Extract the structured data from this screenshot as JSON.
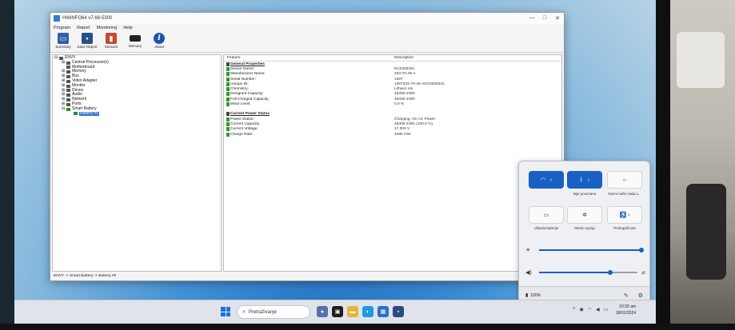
{
  "window": {
    "title": "HWiNFO64 v7.68-5300",
    "controls": [
      "—",
      "□",
      "✕"
    ]
  },
  "menu": [
    "Program",
    "Report",
    "Monitoring",
    "Help"
  ],
  "toolbar": {
    "summary": "Summary",
    "save_report": "Save Report",
    "sensors": "Sensors",
    "memory": "Memory",
    "about": "About"
  },
  "tree": [
    {
      "label": "ENVY",
      "indent": 0,
      "expander": "⊟"
    },
    {
      "label": "Central Processor(s)",
      "indent": 1,
      "expander": "⊞"
    },
    {
      "label": "Motherboard",
      "indent": 1,
      "expander": ""
    },
    {
      "label": "Memory",
      "indent": 1,
      "expander": "⊞"
    },
    {
      "label": "Bus",
      "indent": 1,
      "expander": "⊞"
    },
    {
      "label": "Video Adapter",
      "indent": 1,
      "expander": "⊞"
    },
    {
      "label": "Monitor",
      "indent": 1,
      "expander": "⊞"
    },
    {
      "label": "Drives",
      "indent": 1,
      "expander": "⊞"
    },
    {
      "label": "Audio",
      "indent": 1,
      "expander": "⊞"
    },
    {
      "label": "Network",
      "indent": 1,
      "expander": "⊞"
    },
    {
      "label": "Ports",
      "indent": 1,
      "expander": "⊞"
    },
    {
      "label": "Smart Battery",
      "indent": 1,
      "expander": "⊟"
    },
    {
      "label": "Battery #0",
      "indent": 2,
      "expander": "",
      "selected": true
    }
  ],
  "details": {
    "col_feature": "Feature",
    "col_description": "Description",
    "general_header": "General Properties",
    "general": [
      {
        "feature": "Device Name:",
        "value": "KC04053XL"
      },
      {
        "feature": "Manufacturer Name:",
        "value": "333-70-49-A"
      },
      {
        "feature": "Serial Number:",
        "value": "1367"
      },
      {
        "feature": "Unique ID:",
        "value": "1367333-70-49-AKC04053XL"
      },
      {
        "feature": "Chemistry:",
        "value": "Lithium Ion"
      },
      {
        "feature": "Designed Capacity:",
        "value": "45330 mWh"
      },
      {
        "feature": "Full Charged Capacity:",
        "value": "45330 mWh"
      },
      {
        "feature": "Wear Level:",
        "value": "0.0 %"
      }
    ],
    "power_header": "Current Power Status",
    "power": [
      {
        "feature": "Power Status:",
        "value": "Charging, On AC Power"
      },
      {
        "feature": "Current Capacity:",
        "value": "45308 mWh (100.0 %)"
      },
      {
        "feature": "Current Voltage:",
        "value": "17.304 V"
      },
      {
        "feature": "Charge Rate:",
        "value": "3480 mW"
      }
    ]
  },
  "statusbar": "ENVY -> Smart Battery -> Battery #0",
  "quick_settings": {
    "wifi_label": "",
    "bluetooth_label": "Nije povezano",
    "night_light_label": "Noćni način rada u...",
    "battery_saver_label": "Ušteda baterije",
    "focus_label": "Mesto opcija",
    "accessibility_label": "Pristupačnost",
    "brightness": 1.0,
    "volume": 0.72,
    "battery_percent": "100%"
  },
  "taskbar": {
    "search_placeholder": "Pretraživanje",
    "time": "10:32 am",
    "date": "18/01/2024"
  },
  "colors": {
    "accent": "#1a5fc4",
    "tree_selection": "#2f6fcf",
    "battery_green": "#2f9a2f"
  }
}
